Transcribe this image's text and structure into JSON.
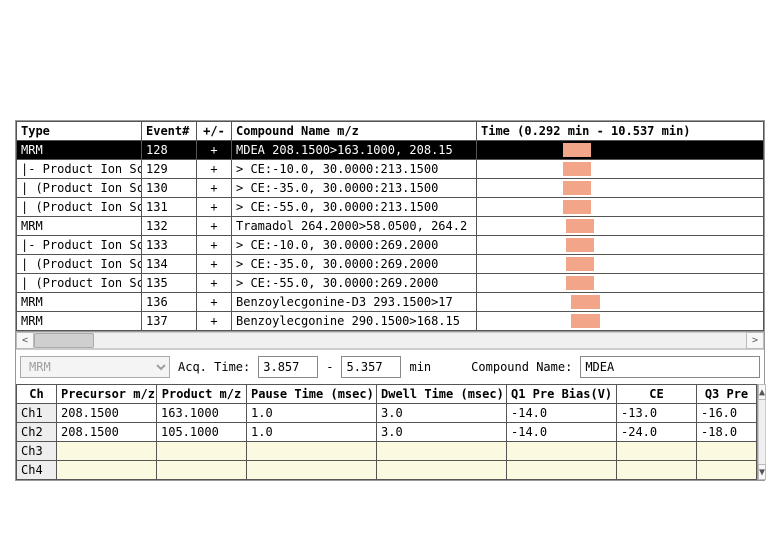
{
  "upper": {
    "headers": [
      "Type",
      "Event#",
      "+/-",
      "Compound Name   m/z",
      "Time (0.292 min - 10.537 min)"
    ],
    "selected_index": 0,
    "rows": [
      {
        "type": "MRM",
        "event": "128",
        "sign": "+",
        "name": "MDEA 208.1500>163.1000, 208.15",
        "bar_l": 0.3,
        "bar_w": 0.1
      },
      {
        "type": "|- Product Ion Scan",
        "event": "129",
        "sign": "+",
        "name": "> CE:-10.0, 30.0000:213.1500",
        "bar_l": 0.3,
        "bar_w": 0.1
      },
      {
        "type": "| (Product Ion Scan)",
        "event": "130",
        "sign": "+",
        "name": "> CE:-35.0, 30.0000:213.1500",
        "bar_l": 0.3,
        "bar_w": 0.1
      },
      {
        "type": "| (Product Ion Scan)",
        "event": "131",
        "sign": "+",
        "name": "> CE:-55.0, 30.0000:213.1500",
        "bar_l": 0.3,
        "bar_w": 0.1
      },
      {
        "type": "MRM",
        "event": "132",
        "sign": "+",
        "name": "Tramadol 264.2000>58.0500, 264.2",
        "bar_l": 0.31,
        "bar_w": 0.1
      },
      {
        "type": "|- Product Ion Scan",
        "event": "133",
        "sign": "+",
        "name": "> CE:-10.0, 30.0000:269.2000",
        "bar_l": 0.31,
        "bar_w": 0.1
      },
      {
        "type": "| (Product Ion Scan)",
        "event": "134",
        "sign": "+",
        "name": "> CE:-35.0, 30.0000:269.2000",
        "bar_l": 0.31,
        "bar_w": 0.1
      },
      {
        "type": "| (Product Ion Scan)",
        "event": "135",
        "sign": "+",
        "name": "> CE:-55.0, 30.0000:269.2000",
        "bar_l": 0.31,
        "bar_w": 0.1
      },
      {
        "type": "MRM",
        "event": "136",
        "sign": "+",
        "name": "Benzoylecgonine-D3 293.1500>17",
        "bar_l": 0.33,
        "bar_w": 0.1
      },
      {
        "type": "MRM",
        "event": "137",
        "sign": "+",
        "name": "Benzoylecgonine 290.1500>168.15",
        "bar_l": 0.33,
        "bar_w": 0.1
      }
    ]
  },
  "mid": {
    "dropdown": "MRM",
    "acq_label": "Acq. Time:",
    "acq_from": "3.857",
    "acq_dash": "-",
    "acq_to": "5.357",
    "acq_unit": "min",
    "cpd_label": "Compound Name:",
    "cpd_value": "MDEA"
  },
  "lower": {
    "headers": [
      "Ch",
      "Precursor m/z",
      "Product m/z",
      "Pause Time (msec)",
      "Dwell Time (msec)",
      "Q1 Pre Bias(V)",
      "CE",
      "Q3 Pre"
    ],
    "rowlabels": [
      "Ch1",
      "Ch2",
      "Ch3",
      "Ch4"
    ],
    "rows": [
      {
        "prec": "208.1500",
        "prod": "163.1000",
        "pause": "1.0",
        "dwell": "3.0",
        "q1": "-14.0",
        "ce": "-13.0",
        "q3": "-16.0"
      },
      {
        "prec": "208.1500",
        "prod": "105.1000",
        "pause": "1.0",
        "dwell": "3.0",
        "q1": "-14.0",
        "ce": "-24.0",
        "q3": "-18.0"
      },
      {},
      {}
    ]
  }
}
